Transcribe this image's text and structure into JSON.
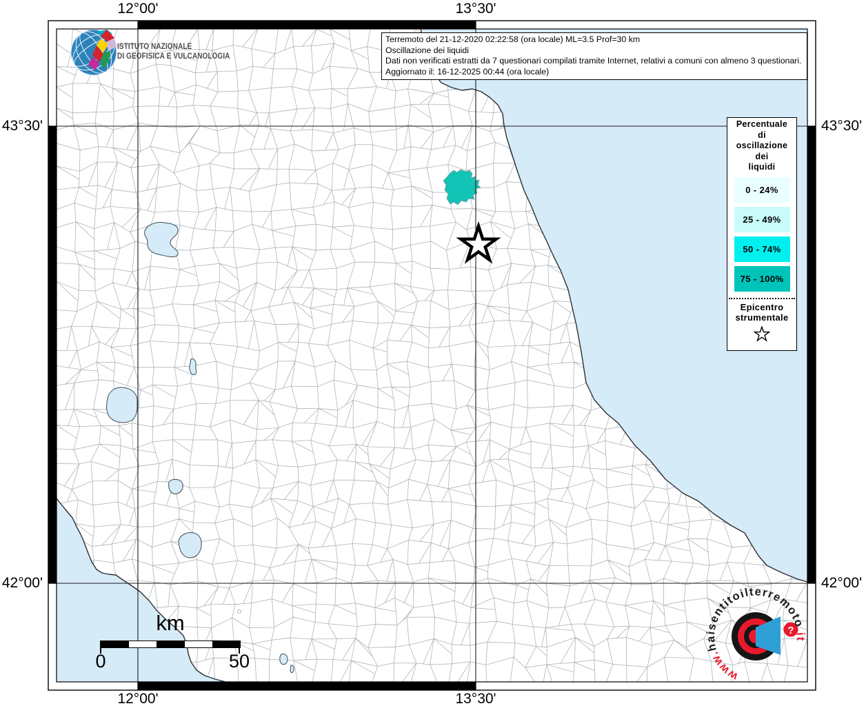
{
  "info_box": {
    "line1": "Terremoto del 21-12-2020 02:22:58 (ora locale) ML=3.5 Prof=30 km",
    "line2": "Oscillazione dei liquidi",
    "line3": "Dati non verificati estratti da 7 questionari compilati tramite Internet, relativi a comuni con almeno 3 questionari.",
    "line4": "Aggiornato il: 16-12-2025 00:44 (ora locale)"
  },
  "branding": {
    "ingv_line1": "ISTITUTO NAZIONALE",
    "ingv_line2": "DI GEOFISICA E VULCANOLOGIA"
  },
  "legend": {
    "title_lines": [
      "Percentuale",
      "di",
      "oscillazione",
      "dei",
      "liquidi"
    ],
    "bins": [
      {
        "label": "0 - 24%",
        "color": "#e9feff"
      },
      {
        "label": "25 - 49%",
        "color": "#c9fbfb"
      },
      {
        "label": "50 - 74%",
        "color": "#00f0f0"
      },
      {
        "label": "75 - 100%",
        "color": "#00c4ba"
      }
    ],
    "epicenter_line1": "Epicentro",
    "epicenter_line2": "strumentale"
  },
  "coords": {
    "lon_w": "12°00'",
    "lon_e": "13°30'",
    "lat_n": "43°30'",
    "lat_s": "42°00'"
  },
  "scalebar": {
    "unit": "km",
    "start": "0",
    "end": "50"
  },
  "site_logo": {
    "prefix": "www.",
    "middle": "haisentitoilterremoto",
    "suffix": ".it",
    "question_mark": "?"
  },
  "map": {
    "sea_color": "#d6ebf8",
    "felt_municipality_color": "#12c4b6",
    "boundary_color": "#adb4ba",
    "accent_red": "#e8192c",
    "accent_blue": "#2f9fd7"
  }
}
